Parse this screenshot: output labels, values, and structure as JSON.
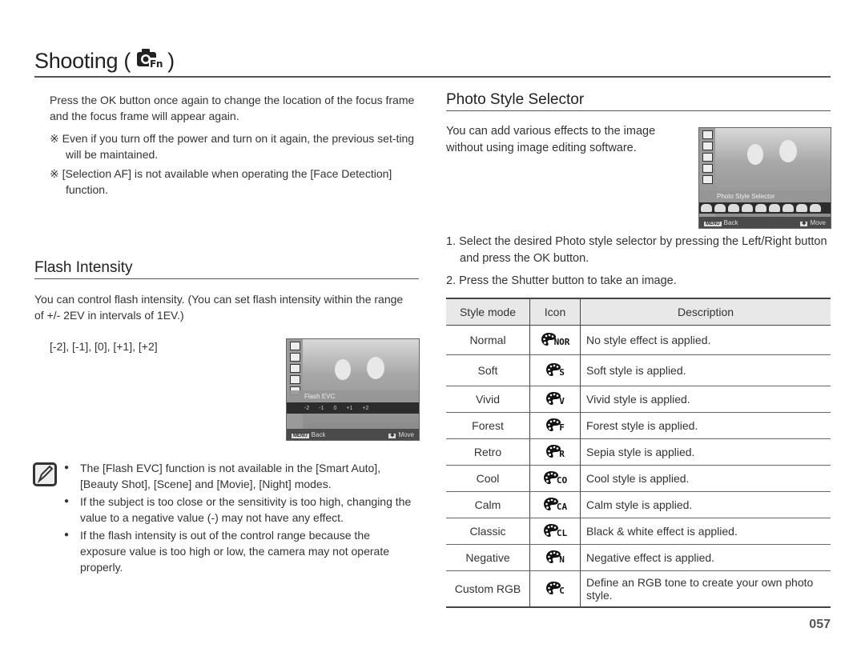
{
  "header": {
    "title": "Shooting (",
    "title_close": ")",
    "icon": "camera-fn-icon"
  },
  "focus_section": {
    "paragraph": "Press the OK button once again to change the location of the focus frame and the focus frame will appear again.",
    "notes": [
      "※  Even if you turn off the power and turn on it again, the previous set-ting will be maintained.",
      "※  [Selection AF] is not available when operating the [Face Detection] function."
    ]
  },
  "flash_intensity": {
    "heading": "Flash Intensity",
    "paragraph": "You can control flash intensity. (You can set flash intensity within the range of +/- 2EV in intervals of 1EV.)",
    "values_text": "[-2], [-1], [0], [+1], [+2]",
    "screen": {
      "label": "Flash EVC",
      "scale": [
        "-2",
        "-1",
        "0",
        "+1",
        "+2"
      ],
      "selected": "0",
      "back_key": "MENU",
      "back_label": "Back",
      "move_label": "Move"
    },
    "note_icon": "note-pencil-icon",
    "bullets": [
      "The [Flash EVC] function is not available in the [Smart Auto], [Beauty Shot], [Scene] and [Movie], [Night] modes.",
      "If the subject is too close or the sensitivity is too high, changing the value to a negative value (-) may not have any effect.",
      "If the flash intensity is out of the control range because the exposure value is too high or low, the camera may not operate properly."
    ]
  },
  "photo_style": {
    "heading": "Photo Style Selector",
    "paragraph": "You can add various effects to the image without using image editing software.",
    "screen": {
      "label": "Photo Style Selector",
      "back_key": "MENU",
      "back_label": "Back",
      "move_label": "Move"
    },
    "steps": [
      "1. Select the desired Photo style selector by pressing the Left/Right button and press the OK button.",
      "2. Press the Shutter button to take an image."
    ],
    "table": {
      "headers": [
        "Style mode",
        "Icon",
        "Description"
      ],
      "rows": [
        {
          "mode": "Normal",
          "code": "NOR",
          "desc": "No style effect is applied."
        },
        {
          "mode": "Soft",
          "code": "S",
          "desc": "Soft style is applied."
        },
        {
          "mode": "Vivid",
          "code": "V",
          "desc": "Vivid style is applied."
        },
        {
          "mode": "Forest",
          "code": "F",
          "desc": "Forest style is applied."
        },
        {
          "mode": "Retro",
          "code": "R",
          "desc": "Sepia style is applied."
        },
        {
          "mode": "Cool",
          "code": "CO",
          "desc": "Cool style is applied."
        },
        {
          "mode": "Calm",
          "code": "CA",
          "desc": "Calm style is applied."
        },
        {
          "mode": "Classic",
          "code": "CL",
          "desc": "Black & white effect is applied."
        },
        {
          "mode": "Negative",
          "code": "N",
          "desc": "Negative effect is applied."
        },
        {
          "mode": "Custom RGB",
          "code": "C",
          "desc": "Define an RGB tone to create your own photo style."
        }
      ]
    }
  },
  "footer": {
    "page_number": "057"
  }
}
